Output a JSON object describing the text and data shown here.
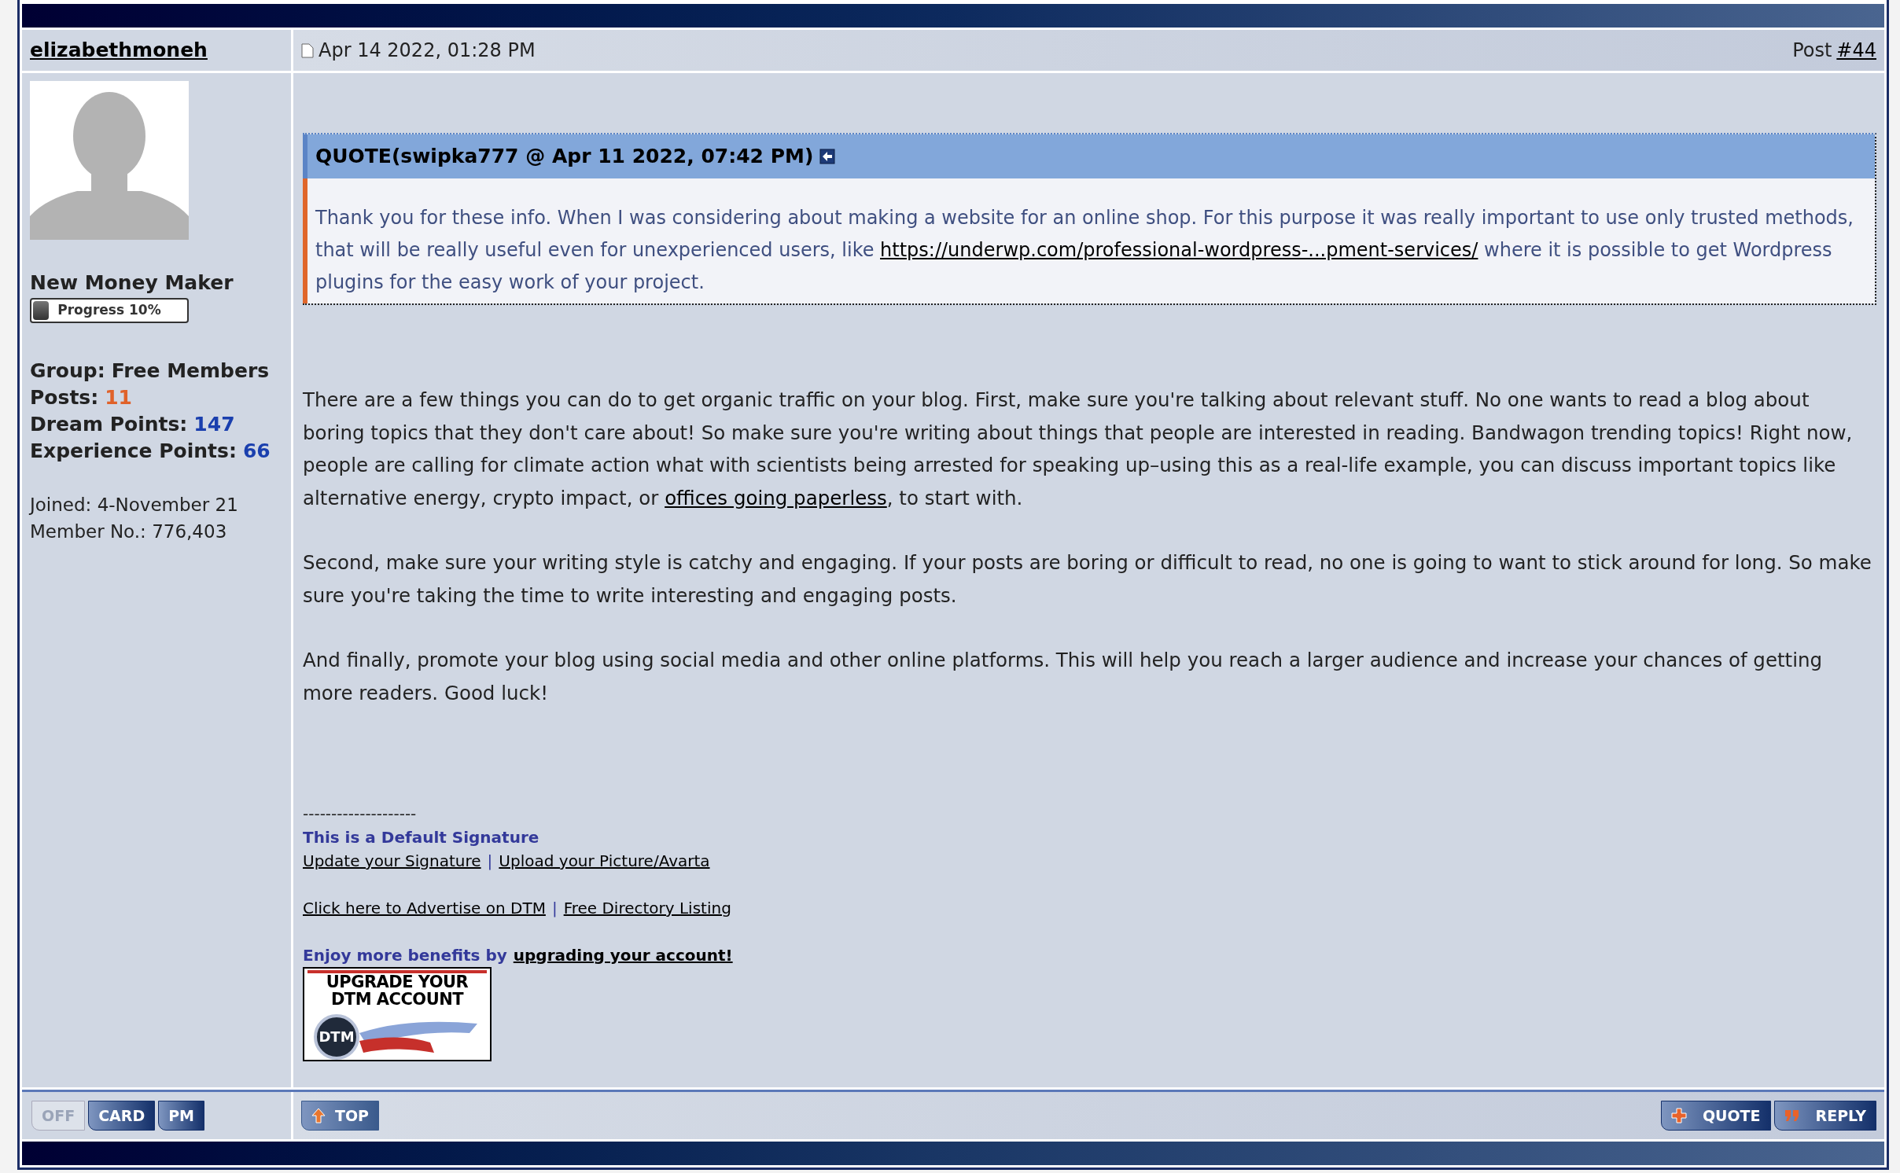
{
  "post": {
    "author": "elizabethmoneh",
    "date": "Apr 14 2022, 01:28 PM",
    "post_label": "Post",
    "post_number": "#44"
  },
  "user": {
    "rank": "New Money Maker",
    "progress": {
      "label": "Progress 10%",
      "level": 0.1
    },
    "stats": [
      {
        "label": "Group:",
        "value": "Free Members",
        "color": "#222222"
      },
      {
        "label": "Posts:",
        "value": "11",
        "color": "#e0622a"
      },
      {
        "label": "Dream Points:",
        "value": "147",
        "color": "#1a3fae"
      },
      {
        "label": "Experience Points:",
        "value": "66",
        "color": "#1a3fae"
      }
    ],
    "details": [
      "Joined: 4-November 21",
      "Member No.: 776,403"
    ]
  },
  "quote": {
    "header": "QUOTE(swipka777 @ Apr 11 2022, 07:42 PM)",
    "before": "Thank you for these info. When I was considering about making a website for an online shop. For this purpose it was really important to use only trusted methods, that will be really useful even for unexperienced users, like ",
    "link": "https://underwp.com/professional-wordpress-...pment-services/",
    "after": " where it is possible to get Wordpress plugins for the easy work of your project."
  },
  "paragraphs": [
    {
      "before": "There are a few things you can do to get organic traffic on your blog. First, make sure you're talking about relevant stuff. No one wants to read a blog about boring topics that they don't care about! So make sure you're writing about things that people are interested in reading. Bandwagon trending topics! Right now, people are calling for climate action what with scientists being arrested for speaking up–using this as a real-life example, you can discuss important topics like alternative energy, crypto impact, or ",
      "link": "offices going paperless",
      "after": ", to start with."
    },
    {
      "before": "Second, make sure your writing style is catchy and engaging. If your posts are boring or difficult to read, no one is going to want to stick around for long. So make sure you're taking the time to write interesting and engaging posts."
    },
    {
      "before": "And finally, promote your blog using social media and other online platforms. This will help you reach a larger audience and increase your chances of getting more readers. Good luck!"
    }
  ],
  "signature": {
    "divider": "--------------------",
    "title": "This is a Default Signature",
    "link_rows": [
      [
        "Update your Signature",
        "Upload your Picture/Avarta"
      ],
      [
        "Click here to Advertise on DTM",
        "Free Directory Listing"
      ]
    ],
    "separator": "|",
    "promo": "Enjoy more benefits by",
    "promo_link": "upgrading your account!",
    "banner": {
      "lines": [
        "UPGRADE YOUR",
        "DTM ACCOUNT"
      ],
      "badge": "DTM"
    }
  },
  "footer": {
    "user_buttons": [
      {
        "label": "OFF",
        "disabled": true
      },
      {
        "label": "CARD",
        "disabled": false
      },
      {
        "label": "PM",
        "disabled": false
      }
    ],
    "post_buttons": [
      {
        "label": "TOP",
        "kind": "up"
      }
    ],
    "reply_buttons": [
      {
        "label": "QUOTE",
        "kind": "plus"
      },
      {
        "label": "REPLY",
        "kind": "quote"
      }
    ]
  }
}
